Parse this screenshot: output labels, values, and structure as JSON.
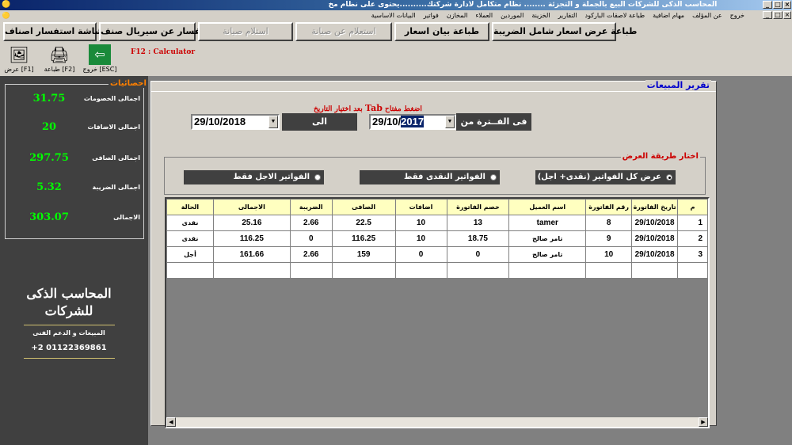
{
  "window": {
    "title": "المحاسب الذكى للشركات البيع بالجملة و التجزئة ........ نظام متكامل لادارة شركتك..........يحتوى على نظام مخ",
    "min": "_",
    "max": "□",
    "close": "×"
  },
  "menu": [
    "البيانات الاساسية",
    "فواتير",
    "المخازن",
    "العملاء",
    "الموردين",
    "الخزينة",
    "التقارير",
    "طباعة لاصقات الباركود",
    "مهام اضافية",
    "عن المؤلف",
    "خروج"
  ],
  "buttons": {
    "items_inquiry_screen": "شاشة استفسار اصناف",
    "serial_inquiry": "استفسار عن سيريال صنف",
    "maintenance_receive": "استلام صيانة",
    "maintenance_inquiry": "استعلام عن صيانة",
    "print_price_list": "طباعة بيان اسعار",
    "print_price_with_tax": "طباعة عرض اسعار شامل الضريبة"
  },
  "toolbar": {
    "view": "عرض [F1]",
    "print": "طباعة [F2]",
    "exit": "خروج [ESC]",
    "calc_hint": "F12 : Calculator"
  },
  "stats": {
    "title": "احصائيات",
    "rows": [
      {
        "label": "اجمالى الخصومات",
        "value": "31.75"
      },
      {
        "label": "اجمالى الاضافات",
        "value": "20"
      },
      {
        "label": "اجمالى الصافى",
        "value": "297.75"
      },
      {
        "label": "اجمالى الضريبة",
        "value": "5.32"
      },
      {
        "label": "الاجمالى",
        "value": "303.07"
      }
    ]
  },
  "brand": {
    "line1": "المحاسب الذكى",
    "line2": "للشركات",
    "support": "المبيعات و الدعم الفنى",
    "phone": "+2 01122369861"
  },
  "report": {
    "title": "تقرير المبيعات",
    "hint_pre": "اضغط مفتاح",
    "hint_key": "Tab",
    "hint_post": "بعد اختيار التاريخ",
    "period_from_label": "فى الفــترة من",
    "to_label": "الى",
    "date_from_prefix": "29/10/",
    "date_from_year": "2017",
    "date_to": "29/10/2018",
    "mode_title": "اختار طريقة العرض",
    "modes": [
      {
        "label": "عرض كل الفواتير (نقدى+ اجل)",
        "selected": true
      },
      {
        "label": "الفواتير النقدى فقط",
        "selected": false
      },
      {
        "label": "الفواتير الاجل فقط",
        "selected": false
      }
    ]
  },
  "grid": {
    "headers": [
      "م",
      "تاريخ الفاتورة",
      "رقم الفاتورة",
      "اسم العميل",
      "خصم الفاتورة",
      "اضافات",
      "الصافى",
      "الضريبة",
      "الاجمالى",
      "الحالة"
    ],
    "rows": [
      [
        "1",
        "29/10/2018",
        "8",
        "tamer",
        "13",
        "10",
        "22.5",
        "2.66",
        "25.16",
        "نقدى"
      ],
      [
        "2",
        "29/10/2018",
        "9",
        "تامر صالح",
        "18.75",
        "10",
        "116.25",
        "0",
        "116.25",
        "نقدى"
      ],
      [
        "3",
        "29/10/2018",
        "10",
        "تامر صالح",
        "0",
        "0",
        "159",
        "2.66",
        "161.66",
        "أجل"
      ]
    ]
  },
  "colors": {
    "stat_value": "#00ff00",
    "stats_title": "#ff8000",
    "report_title": "#0000cc",
    "hint": "#cc0000",
    "grid_header": "#ffffc0"
  }
}
